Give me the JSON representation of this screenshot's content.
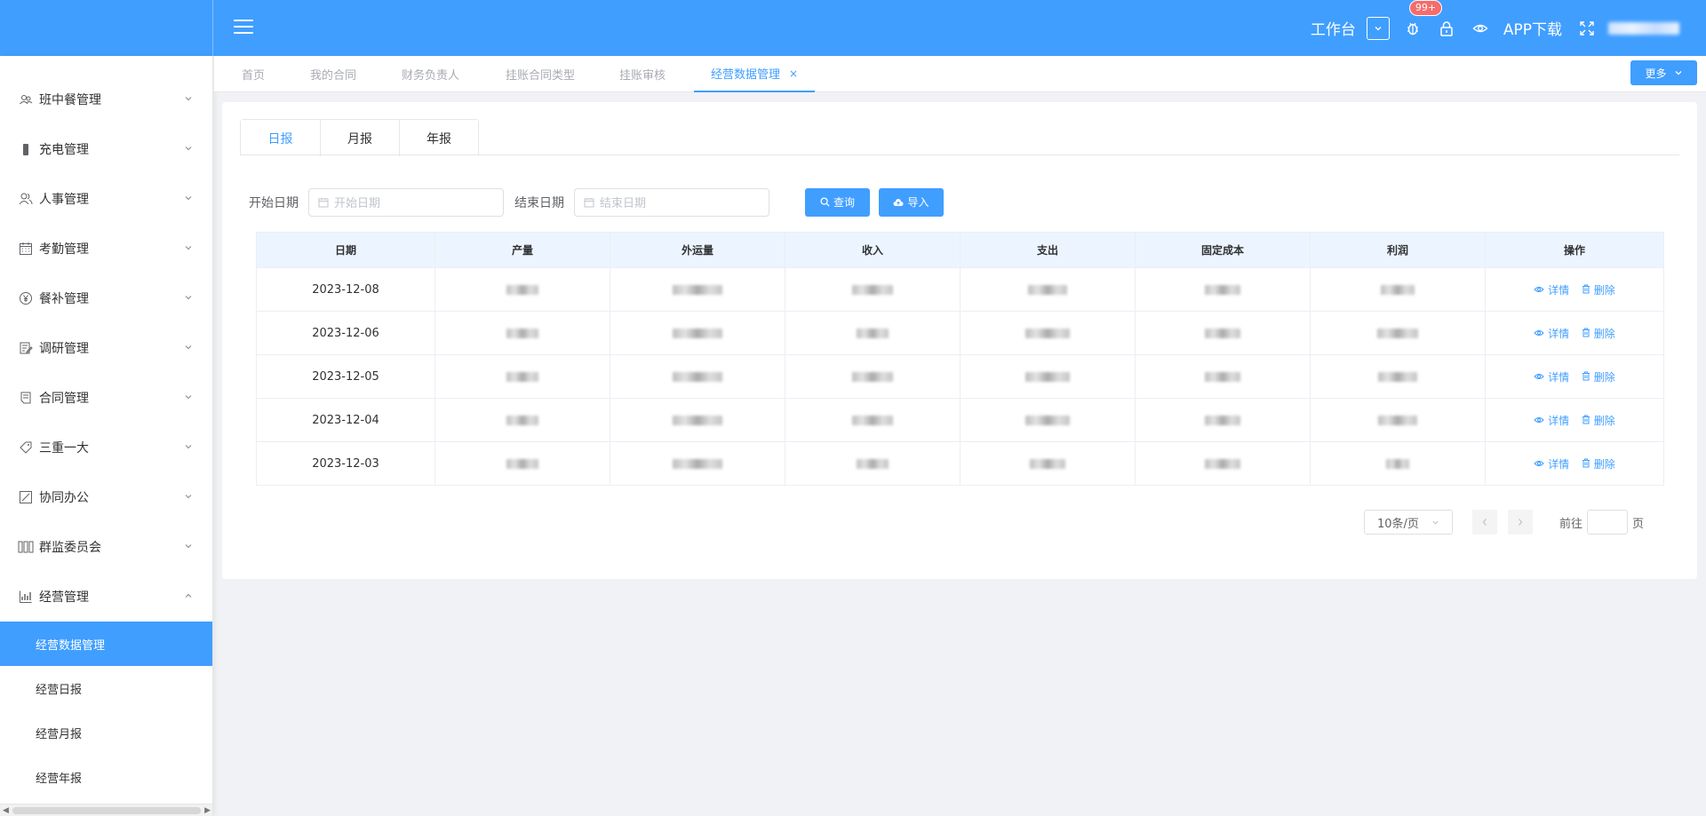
{
  "header": {
    "workbench": "工作台",
    "badge": "99+",
    "app_download": "APP下载"
  },
  "sidebar": {
    "items": [
      {
        "label": "班中餐管理",
        "icon": "people-icon"
      },
      {
        "label": "充电管理",
        "icon": "battery-icon"
      },
      {
        "label": "人事管理",
        "icon": "users-icon"
      },
      {
        "label": "考勤管理",
        "icon": "calendar-icon"
      },
      {
        "label": "餐补管理",
        "icon": "yen-icon"
      },
      {
        "label": "调研管理",
        "icon": "edit-doc-icon"
      },
      {
        "label": "合同管理",
        "icon": "contract-icon"
      },
      {
        "label": "三重一大",
        "icon": "tag-icon"
      },
      {
        "label": "协同办公",
        "icon": "pen-square-icon"
      },
      {
        "label": "群监委员会",
        "icon": "committee-icon"
      },
      {
        "label": "经营管理",
        "icon": "chart-icon"
      }
    ],
    "sub_items": [
      "经营数据管理",
      "经营日报",
      "经营月报",
      "经营年报"
    ]
  },
  "route_tabs": [
    "首页",
    "我的合同",
    "财务负责人",
    "挂账合同类型",
    "挂账审核",
    "经营数据管理"
  ],
  "more_label": "更多",
  "report_tabs": [
    "日报",
    "月报",
    "年报"
  ],
  "filters": {
    "start_label": "开始日期",
    "start_placeholder": "开始日期",
    "end_label": "结束日期",
    "end_placeholder": "结束日期",
    "query_label": "查询",
    "import_label": "导入"
  },
  "table": {
    "headers": [
      "日期",
      "产量",
      "外运量",
      "收入",
      "支出",
      "固定成本",
      "利润",
      "操作"
    ],
    "rows": [
      {
        "date": "2023-12-08"
      },
      {
        "date": "2023-12-06"
      },
      {
        "date": "2023-12-05"
      },
      {
        "date": "2023-12-04"
      },
      {
        "date": "2023-12-03"
      }
    ],
    "detail_label": "详情",
    "delete_label": "删除"
  },
  "pagination": {
    "page_size": "10条/页",
    "goto_label": "前往",
    "page_suffix": "页"
  },
  "colors": {
    "primary": "#409eff",
    "badge": "#f56c6c"
  }
}
